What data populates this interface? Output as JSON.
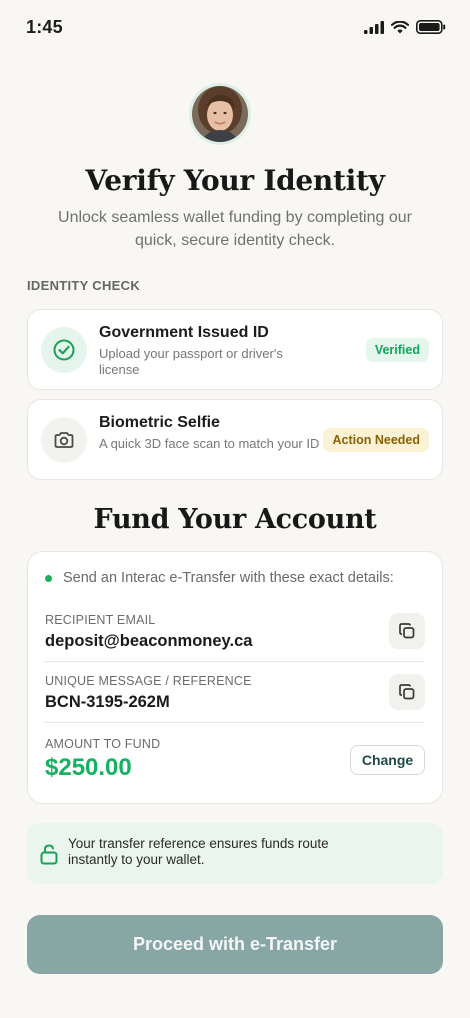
{
  "status_bar": {
    "time": "1:45",
    "icons": [
      "signal-icon",
      "wifi-icon",
      "battery-icon"
    ]
  },
  "header": {
    "title": "Verify Your Identity",
    "subtitle": "Unlock seamless wallet funding by completing our quick, secure identity check."
  },
  "identity_check": {
    "label": "IDENTITY CHECK",
    "items": [
      {
        "title": "Government Issued ID",
        "description": "Upload your passport or driver's license",
        "status": "Verified",
        "icon": "check-circle-icon"
      },
      {
        "title": "Biometric Selfie",
        "description": "A quick 3D face scan to match your ID",
        "status": "Action Needed",
        "icon": "camera-icon"
      }
    ]
  },
  "fund": {
    "title": "Fund Your Account",
    "note": "Send an Interac e-Transfer with these exact details:",
    "recipient_label": "RECIPIENT EMAIL",
    "recipient_value": "deposit@beaconmoney.ca",
    "reference_label": "UNIQUE MESSAGE / REFERENCE",
    "reference_value": "BCN-3195-262M",
    "amount_label": "AMOUNT TO FUND",
    "amount_value": "$250.00",
    "change_label": "Change"
  },
  "secure_note": "Your transfer reference ensures funds route instantly to your wallet.",
  "proceed_label": "Proceed with e-Transfer",
  "colors": {
    "accent_green": "#16b062",
    "button_disabled": "#88a6a4",
    "background": "#f8f7f3"
  }
}
